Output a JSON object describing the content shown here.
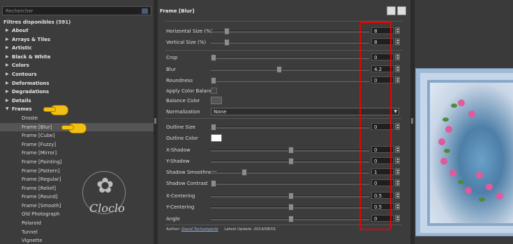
{
  "search": {
    "placeholder": "Rechercher",
    "icon": "search-icon"
  },
  "filters": {
    "count_label": "Filtres disponibles (591)",
    "items": [
      {
        "label": "About",
        "italic": true
      },
      {
        "label": "Arrays & Tiles"
      },
      {
        "label": "Artistic"
      },
      {
        "label": "Black & White"
      },
      {
        "label": "Colors"
      },
      {
        "label": "Contours"
      },
      {
        "label": "Deformations"
      },
      {
        "label": "Degradations"
      },
      {
        "label": "Details"
      },
      {
        "label": "Frames",
        "expanded": true
      }
    ],
    "frames_children": [
      "Droste",
      "Frame [Blur]",
      "Frame [Cube]",
      "Frame [Fuzzy]",
      "Frame [Mirror]",
      "Frame [Painting]",
      "Frame [Pattern]",
      "Frame [Regular]",
      "Frame [Relief]",
      "Frame [Round]",
      "Frame [Smooth]",
      "Old Photograph",
      "Polaroid",
      "Tunnel",
      "Vignette"
    ],
    "selected": "Frame [Blur]"
  },
  "watermark": {
    "text": "Cloclo"
  },
  "panel": {
    "title": "Frame [Blur]",
    "params": [
      {
        "label": "Horizontal Size (%)",
        "value": "8",
        "slider": 0.09
      },
      {
        "label": "Vertical Size (%)",
        "value": "8",
        "slider": 0.09
      },
      {
        "label": "Crop",
        "value": "0",
        "slider": 0.0
      },
      {
        "label": "Blur",
        "value": "4.2",
        "slider": 0.42
      },
      {
        "label": "Roundness",
        "value": "0",
        "slider": 0.0
      },
      {
        "label": "Apply Color Balance"
      },
      {
        "label": "Balance Color"
      },
      {
        "label": "Normalization",
        "select": "None"
      },
      {
        "label": "Outline Size",
        "value": "0",
        "slider": 0.0
      },
      {
        "label": "Outline Color"
      },
      {
        "label": "X-Shadow",
        "value": "0",
        "slider": 0.5
      },
      {
        "label": "Y-Shadow",
        "value": "0",
        "slider": 0.5
      },
      {
        "label": "Shadow Smoothness",
        "value": "1",
        "slider": 0.2
      },
      {
        "label": "Shadow Contrast",
        "value": "0",
        "slider": 0.0
      },
      {
        "label": "X-Centering",
        "value": "0.5",
        "slider": 0.5
      },
      {
        "label": "Y-Centering",
        "value": "0.5",
        "slider": 0.5
      },
      {
        "label": "Angle",
        "value": "0",
        "slider": 0.5
      }
    ],
    "footer": {
      "author_label": "Author:",
      "author_name": "David Tschumperlé",
      "update_label": "Latest Update:",
      "update_date": "2014/08/01"
    }
  },
  "colors": {
    "highlight_box": "#e00000",
    "balance_color": "#555555",
    "outline_color": "#ffffff"
  }
}
